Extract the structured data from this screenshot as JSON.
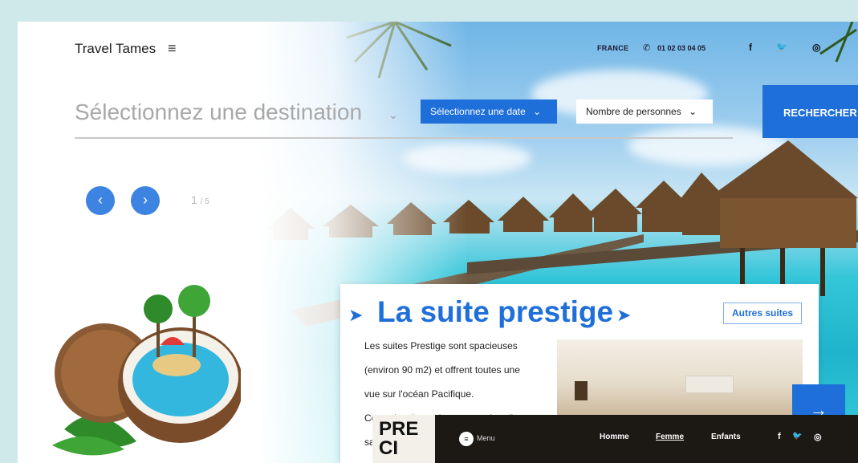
{
  "header": {
    "brand": "Travel Tames",
    "menu_icon": "hamburger-icon",
    "country": "FRANCE",
    "phone": "01 02 03 04 05",
    "social": [
      "f",
      "🐦",
      "◎"
    ]
  },
  "search": {
    "destination_placeholder": "Sélectionnez une destination",
    "date_label": "Sélectionnez une date",
    "people_label": "Nombre de personnes",
    "search_label": "RECHERCHER"
  },
  "carousel": {
    "current": "1",
    "total": "/ 5"
  },
  "card": {
    "title": "La suite prestige",
    "other_suites": "Autres suites",
    "lines": [
      "Les suites Prestige sont spacieuses",
      "(environ 90 m2) et offrent toutes une",
      "vue sur l'océan Pacifique.",
      "Ces suites bungalos composées d'un",
      "sa"
    ]
  },
  "page2": {
    "logo_line1": "PRE",
    "logo_line2": "CI",
    "menu_label": "Menu",
    "nav": [
      "Homme",
      "Femme",
      "Enfants"
    ],
    "social": [
      "f",
      "🐦",
      "◎"
    ]
  },
  "colors": {
    "accent": "#1e6fd9",
    "page_bg": "#cfe9ea"
  }
}
